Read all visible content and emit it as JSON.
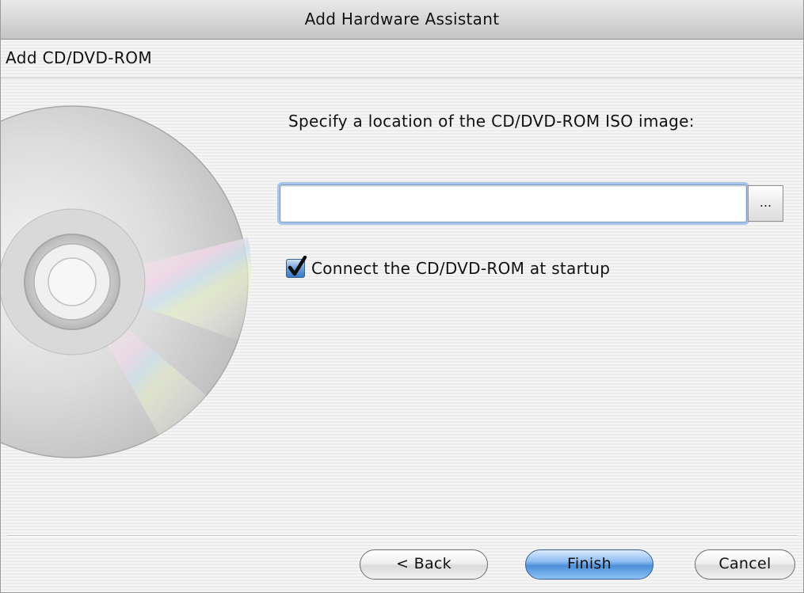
{
  "window": {
    "title": "Add Hardware Assistant"
  },
  "header": {
    "heading": "Add CD/DVD-ROM"
  },
  "main": {
    "prompt": "Specify a location of the CD/DVD-ROM ISO image:",
    "iso_path": {
      "value": "",
      "placeholder": ""
    },
    "browse_label": "...",
    "connect_checkbox": {
      "label": "Connect the CD/DVD-ROM at startup",
      "checked": true
    }
  },
  "footer": {
    "back_label": "< Back",
    "finish_label": "Finish",
    "cancel_label": "Cancel"
  },
  "icons": {
    "disc": "cd-disc-icon",
    "checkmark": "checkmark-icon"
  },
  "colors": {
    "accent": "#4d8fd9",
    "focus_ring": "#a9c6ea"
  }
}
